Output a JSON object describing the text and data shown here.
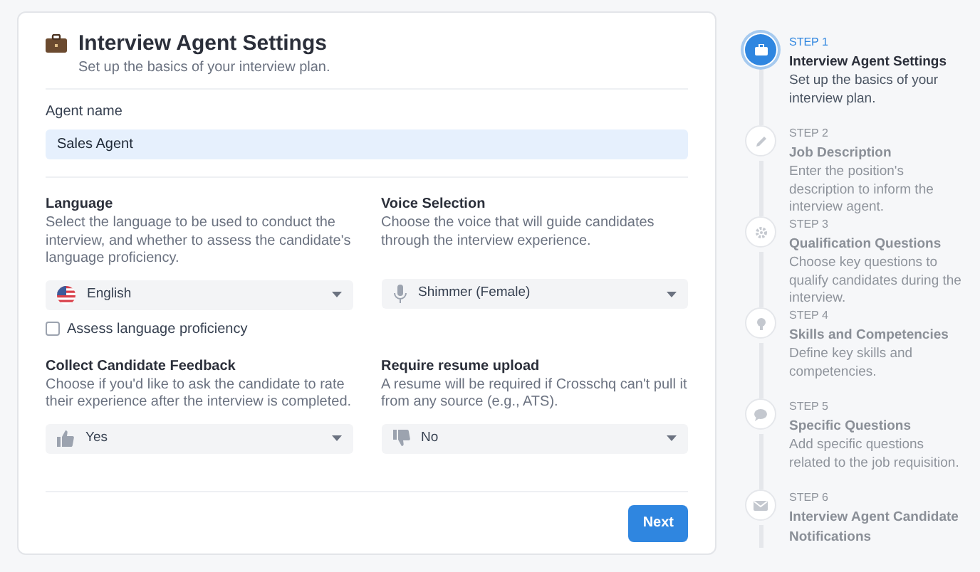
{
  "header": {
    "title": "Interview Agent Settings",
    "subtitle": "Set up the basics of your interview plan."
  },
  "agent_name": {
    "label": "Agent name",
    "value": "Sales Agent"
  },
  "sections": [
    {
      "title": "Language",
      "description": "Select the language to be used to conduct the interview, and whether to assess the candidate's language proficiency.",
      "dropdown": {
        "kind": "flag",
        "value": "English"
      },
      "checkbox": {
        "label": "Assess language proficiency",
        "checked": false
      }
    },
    {
      "title": "Voice Selection",
      "description": "Choose the voice that will guide candidates through the interview experience.",
      "dropdown": {
        "kind": "mic",
        "value": "Shimmer (Female)"
      }
    },
    {
      "title": "Collect Candidate Feedback",
      "description": "Choose if you'd like to ask the candidate to rate their experience after the interview is completed.",
      "dropdown": {
        "kind": "thumbs-up",
        "value": "Yes"
      }
    },
    {
      "title": "Require resume upload",
      "description": "A resume will be required if Crosschq can't pull it from any source (e.g., ATS).",
      "dropdown": {
        "kind": "thumbs-down",
        "value": "No"
      }
    }
  ],
  "next_button": "Next",
  "steps": [
    {
      "kind": "briefcase",
      "step": "STEP 1",
      "title": "Interview Agent Settings",
      "description": "Set up the basics of your interview plan.",
      "selected": true
    },
    {
      "kind": "pencil",
      "step": "STEP 2",
      "title": "Job Description",
      "description": "Enter the position's description to inform the interview agent.",
      "selected": false
    },
    {
      "kind": "gear",
      "step": "STEP 3",
      "title": "Qualification Questions",
      "description": "Choose key questions to qualify candidates during the interview.",
      "selected": false
    },
    {
      "kind": "bulb",
      "step": "STEP 4",
      "title": "Skills and Competencies",
      "description": "Define key skills and competencies.",
      "selected": false
    },
    {
      "kind": "chat",
      "step": "STEP 5",
      "title": "Specific Questions",
      "description": "Add specific questions related to the job requisition.",
      "selected": false
    },
    {
      "kind": "mail",
      "step": "STEP 6",
      "title": "Interview Agent Candidate Notifications",
      "selected": false
    }
  ]
}
